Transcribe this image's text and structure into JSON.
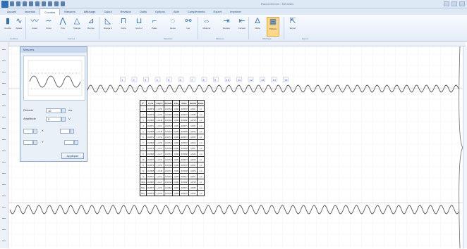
{
  "window": {
    "title": "Raccordement - Mérantes"
  },
  "tabs": [
    {
      "label": "Accueil",
      "active": false
    },
    {
      "label": "Insertion",
      "active": false
    },
    {
      "label": "Courbes",
      "active": true
    },
    {
      "label": "Mesures",
      "active": false
    },
    {
      "label": "Affichage",
      "active": false
    },
    {
      "label": "Calcul",
      "active": false
    },
    {
      "label": "Révision",
      "active": false
    },
    {
      "label": "Outils",
      "active": false
    },
    {
      "label": "Options",
      "active": false
    },
    {
      "label": "Aide",
      "active": false
    },
    {
      "label": "Compléments",
      "active": false
    },
    {
      "label": "Export",
      "active": false
    },
    {
      "label": "Imprimer",
      "active": false
    }
  ],
  "ribbon": {
    "buttons": [
      {
        "icon": "chart-icon",
        "label": "Courbe",
        "selected": false
      },
      {
        "icon": "curve-icon",
        "label": "Ajuster",
        "selected": false
      },
      {
        "icon": "wave-icon",
        "label": "Lisser",
        "selected": false
      },
      {
        "icon": "sine-icon",
        "label": "Sinus",
        "selected": false
      },
      {
        "icon": "peak-icon",
        "label": "Pics",
        "selected": false
      },
      {
        "icon": "triangle-icon",
        "label": "Triangle",
        "selected": false
      },
      {
        "icon": "ramp-icon",
        "label": "Rampe",
        "selected": false
      },
      {
        "icon": "ramp2-icon",
        "label": "Rampe 2",
        "selected": false
      },
      {
        "icon": "square-icon",
        "label": "Carré",
        "selected": false
      },
      {
        "icon": "square2-icon",
        "label": "Carré 2",
        "selected": false
      },
      {
        "icon": "step-icon",
        "label": "Palier",
        "selected": false
      },
      {
        "icon": "lasso-icon",
        "label": "Lasso",
        "selected": false
      },
      {
        "icon": "link-icon",
        "label": "Lier",
        "selected": false
      },
      {
        "icon": "measure-icon",
        "label": "Mesurer",
        "selected": false
      },
      {
        "icon": "marker-icon",
        "label": "Repère",
        "selected": false
      },
      {
        "icon": "cursor-icon",
        "label": "Curseur",
        "selected": false
      },
      {
        "icon": "delta-icon",
        "label": "Delta",
        "selected": false
      },
      {
        "icon": "table-icon",
        "label": "Tableau",
        "selected": true
      },
      {
        "icon": "export-icon",
        "label": "Export",
        "selected": false
      }
    ],
    "groups": [
      "Courbes",
      "Formes",
      "Sélection",
      "Mesures",
      "Affichage",
      "Export"
    ]
  },
  "dialog": {
    "title": "Mesures",
    "field1_label": "Période",
    "field1_value": "10",
    "field1_unit": "ms",
    "field2_label": "Amplitude",
    "field2_value": "5",
    "field2_unit": "V",
    "x_label": "X",
    "y_label": "Y",
    "ok_label": "Appliquer"
  },
  "markers": {
    "labels": [
      "1",
      "2",
      "3",
      "4",
      "5",
      "6",
      "7",
      "8",
      "9",
      "10",
      "11",
      "12",
      "13",
      "14",
      "15"
    ]
  },
  "table": {
    "headers": [
      "N°",
      "Cycle",
      "Amp A",
      "Période",
      "Fréq",
      "Pente",
      "Retard",
      "Phase"
    ],
    "rows": [
      [
        "1",
        "26,8870",
        "1,1250",
        "10,0050",
        "1,000",
        "20,8070",
        "1,0021",
        "2,1"
      ],
      [
        "2",
        "26,8870",
        "1,1250",
        "10,0060",
        "0,999",
        "20,8070",
        "1,0030",
        "2,4"
      ],
      [
        "3",
        "26,8865",
        "1,1248",
        "10,0040",
        "1,000",
        "20,8060",
        "1,0018",
        "2,2"
      ],
      [
        "4",
        "26,8871",
        "1,1251",
        "10,0050",
        "1,000",
        "20,8075",
        "1,0022",
        "2,3"
      ],
      [
        "5",
        "26,8868",
        "1,1249",
        "10,0045",
        "0,999",
        "20,8068",
        "1,0025",
        "2,2"
      ],
      [
        "6",
        "26,8872",
        "1,1252",
        "10,0055",
        "1,000",
        "20,8072",
        "1,0020",
        "2,1"
      ],
      [
        "7",
        "26,8869",
        "1,1250",
        "10,0050",
        "1,000",
        "20,8070",
        "1,0023",
        "2,3"
      ],
      [
        "8",
        "26,8870",
        "1,1251",
        "10,0048",
        "0,999",
        "20,8069",
        "1,0021",
        "2,2"
      ],
      [
        "9",
        "26,8866",
        "1,1247",
        "10,0052",
        "1,000",
        "20,8066",
        "1,0026",
        "2,4"
      ],
      [
        "10",
        "26,8873",
        "1,1253",
        "10,0050",
        "1,000",
        "20,8073",
        "1,0019",
        "2,1"
      ],
      [
        "11",
        "26,8870",
        "1,1250",
        "10,0049",
        "0,999",
        "20,8070",
        "1,0022",
        "2,2"
      ],
      [
        "12",
        "26,8868",
        "1,1249",
        "10,0051",
        "1,000",
        "20,8068",
        "1,0024",
        "2,3"
      ],
      [
        "13",
        "26,8871",
        "1,1251",
        "10,0050",
        "1,000",
        "20,8071",
        "1,0021",
        "2,2"
      ],
      [
        "Min",
        "26,8865",
        "1,1247",
        "10,0040",
        "0,999",
        "20,8060",
        "1,0018",
        "2,1"
      ],
      [
        "Max",
        "26,8873",
        "1,1253",
        "10,0060",
        "1,000",
        "20,8075",
        "1,0030",
        "2,4"
      ],
      [
        "Moy",
        "26,8870",
        "1,1250",
        "10,0050",
        "1,000",
        "20,8070",
        "1,0022",
        "2,2"
      ]
    ]
  },
  "colors": {
    "accent": "#2f6fb6",
    "waveform": "#555555",
    "marker_text": "#3c52c9",
    "selected_button": "#fcd88a"
  }
}
